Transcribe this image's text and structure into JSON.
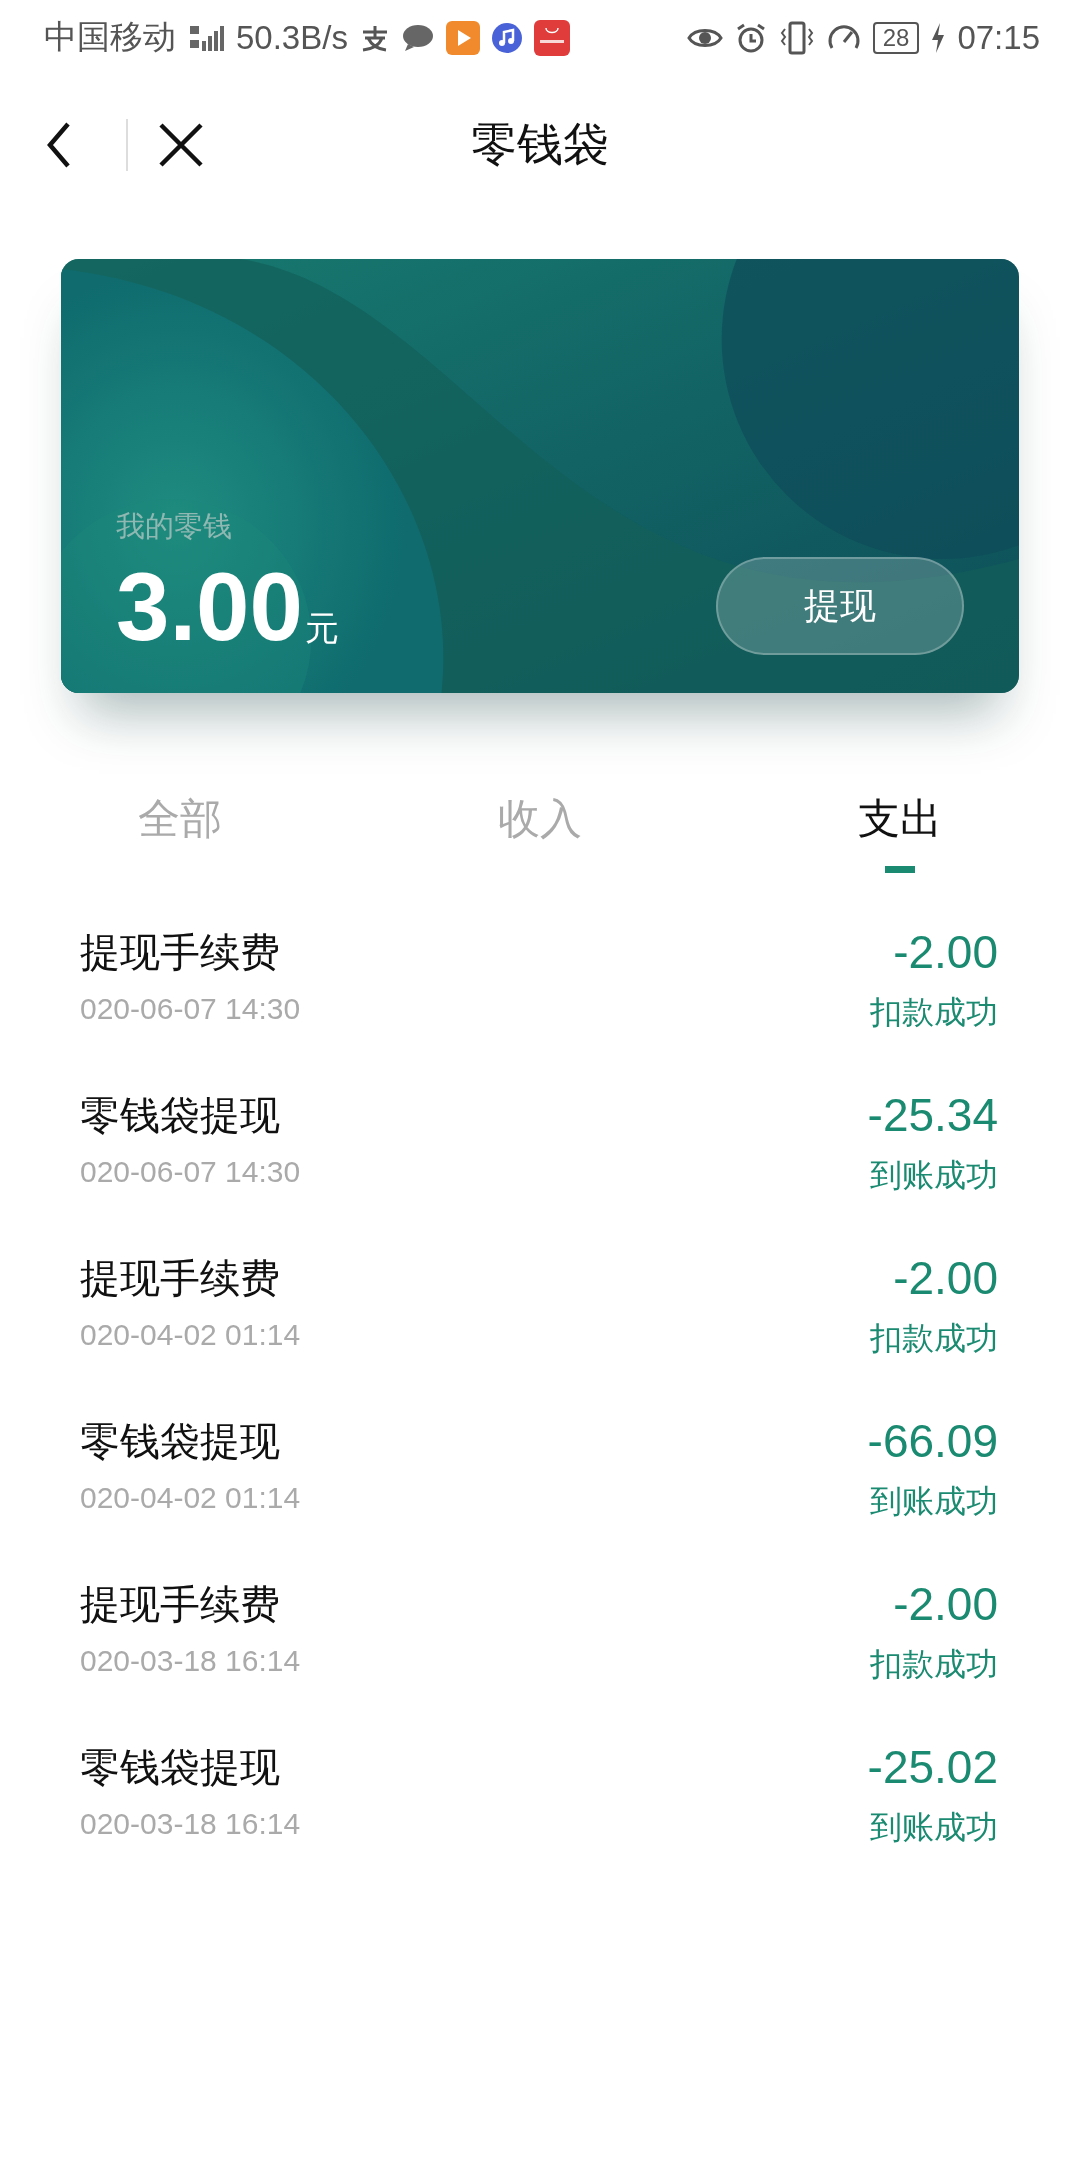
{
  "status_bar": {
    "carrier": "中国移动",
    "speed": "50.3B/s",
    "battery": "28",
    "time": "07:15"
  },
  "header": {
    "title": "零钱袋"
  },
  "balance_card": {
    "label": "我的零钱",
    "amount": "3.00",
    "unit": "元",
    "button": "提现"
  },
  "tabs": [
    {
      "label": "全部",
      "selected": false
    },
    {
      "label": "收入",
      "selected": false
    },
    {
      "label": "支出",
      "selected": true
    }
  ],
  "transactions": [
    {
      "title": "提现手续费",
      "date": "020-06-07 14:30",
      "amount": "-2.00",
      "status": "扣款成功"
    },
    {
      "title": "零钱袋提现",
      "date": "020-06-07 14:30",
      "amount": "-25.34",
      "status": "到账成功"
    },
    {
      "title": "提现手续费",
      "date": "020-04-02 01:14",
      "amount": "-2.00",
      "status": "扣款成功"
    },
    {
      "title": "零钱袋提现",
      "date": "020-04-02 01:14",
      "amount": "-66.09",
      "status": "到账成功"
    },
    {
      "title": "提现手续费",
      "date": "020-03-18 16:14",
      "amount": "-2.00",
      "status": "扣款成功"
    },
    {
      "title": "零钱袋提现",
      "date": "020-03-18 16:14",
      "amount": "-25.02",
      "status": "到账成功"
    }
  ]
}
